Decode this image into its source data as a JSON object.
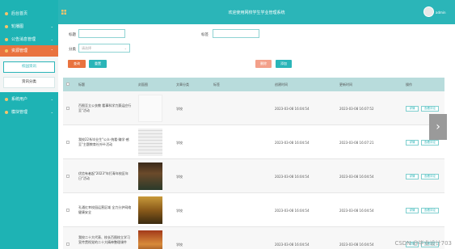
{
  "header": {
    "title": "欢迎使用网校学生学业管理系统",
    "user": "admin"
  },
  "sidebar": {
    "items": [
      {
        "label": "后台首页"
      },
      {
        "label": "轮播图"
      },
      {
        "label": "公告消息管理"
      },
      {
        "label": "资源管理"
      },
      {
        "label": "系统用户"
      },
      {
        "label": "模块管理"
      }
    ],
    "sub": [
      {
        "label": "校园资讯"
      },
      {
        "label": "资讯分类"
      }
    ]
  },
  "filters": {
    "title_label": "标题",
    "tag_label": "标签",
    "category_label": "分类",
    "category_placeholder": "请选择",
    "search_btn": "查询",
    "reset_btn": "重置",
    "delete_btn": "删除",
    "add_btn": "添加"
  },
  "table": {
    "headers": [
      "标题",
      "封面图",
      "文章分类",
      "标签",
      "创建时间",
      "更新时间",
      "操作"
    ],
    "rows": [
      {
        "title": "百图至立公衣教 看事科学力赛运应行至\"活动",
        "category": "学校",
        "created": "2023-03-08 16:04:54",
        "updated": "2023-03-08 16:07:52"
      },
      {
        "title": "我校22系毕业生\"公众·统看·赚学·感至\"主题教育社外H·活动",
        "category": "学校",
        "created": "2023-03-08 16:04:54",
        "updated": "2023-03-08 16:07:21"
      },
      {
        "title": "优信有者起\"2023\"年打青年校区年日\"活动",
        "category": "学校",
        "created": "2023-03-08 16:04:54",
        "updated": "2023-03-08 16:04:54"
      },
      {
        "title": "孔通红幸校园运营区域 全力分护网络健康安全",
        "category": "学校",
        "created": "2023-03-08 16:04:54",
        "updated": "2023-03-08 16:04:54"
      },
      {
        "title": "我校二十大代表、校长百图校立学习宣传贯彻党的二十大精神整理课件",
        "category": "学校",
        "created": "2023-03-08 16:04:54",
        "updated": "2023-03-08 16:04:54"
      }
    ],
    "edit_btn": "详情",
    "delete_btn": "查看评论"
  },
  "watermark": "CSDN @毕业设计703"
}
